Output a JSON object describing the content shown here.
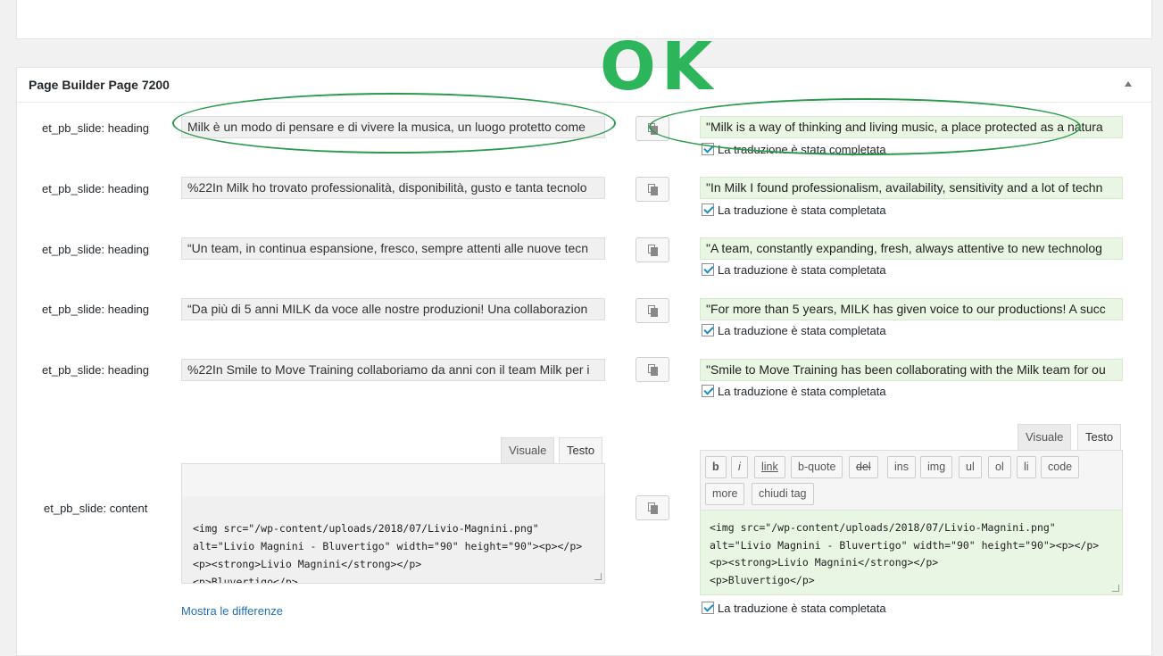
{
  "stamp": "OK",
  "panel": {
    "title": "Page Builder Page 7200"
  },
  "rows": [
    {
      "label": "et_pb_slide: heading",
      "source": "Milk è un modo di pensare e di vivere la musica, un luogo protetto come",
      "target": "\"Milk is a way of thinking and living music, a place protected as a natura",
      "complete_label": "La traduzione è stata completata"
    },
    {
      "label": "et_pb_slide: heading",
      "source": "%22In Milk ho trovato professionalità, disponibilità, gusto e tanta tecnolo",
      "target": "\"In Milk I found professionalism, availability, sensitivity and a lot of techn",
      "complete_label": "La traduzione è stata completata"
    },
    {
      "label": "et_pb_slide: heading",
      "source": "“Un team, in continua espansione, fresco, sempre attenti alle nuove tecn",
      "target": "\"A team, constantly expanding, fresh, always attentive to new technolog",
      "complete_label": "La traduzione è stata completata"
    },
    {
      "label": "et_pb_slide: heading",
      "source": "“Da più di 5 anni MILK da voce alle nostre produzioni! Una collaborazion",
      "target": "\"For more than 5 years, MILK has given voice to our productions! A succ",
      "complete_label": "La traduzione è stata completata"
    },
    {
      "label": "et_pb_slide: heading",
      "source": "%22In Smile to Move Training collaboriamo da anni con il team Milk per i",
      "target": "\"Smile to Move Training has been collaborating with the Milk team for ou",
      "complete_label": "La traduzione è stata completata"
    }
  ],
  "content_row": {
    "label": "et_pb_slide: content",
    "tabs": {
      "visual": "Visuale",
      "text": "Testo"
    },
    "source_lines": [
      "<img src=\"/wp-content/uploads/2018/07/Livio-Magnini.png\"",
      "alt=\"Livio Magnini - Bluvertigo\" width=\"90\" height=\"90\"><p></p>",
      "<p><strong>Livio Magnini</strong></p>",
      "<p>Bluvertigo</p>"
    ],
    "target_lines": [
      "<img src=\"/wp-content/uploads/2018/07/Livio-Magnini.png\"",
      "alt=\"Livio Magnini - Bluvertigo\" width=\"90\" height=\"90\"><p></p>",
      "<p><strong>Livio Magnini</strong></p>",
      "<p>Bluvertigo</p>"
    ],
    "toolbar": [
      "b",
      "i",
      "link",
      "b-quote",
      "del",
      "ins",
      "img",
      "ul",
      "ol",
      "li",
      "code",
      "more",
      "chiudi tag"
    ],
    "complete_label": "La traduzione è stata completata",
    "diff_link": "Mostra le differenze"
  },
  "colors": {
    "ok_green": "#2cb55b",
    "target_bg": "#eaf6e4",
    "link": "#2271b1"
  }
}
